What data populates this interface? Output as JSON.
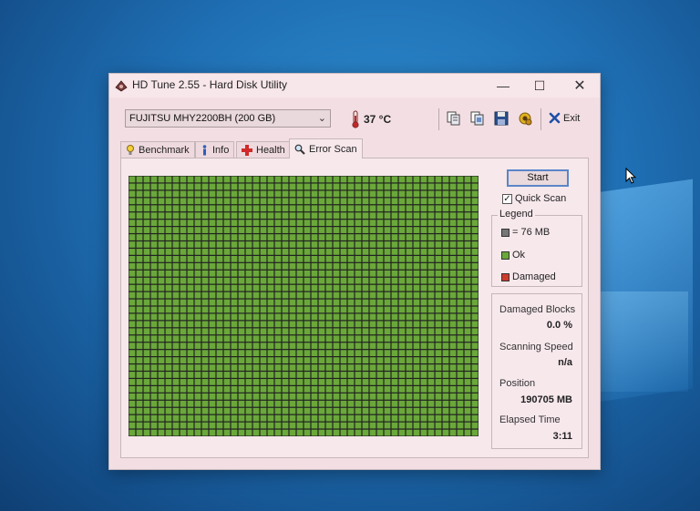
{
  "window": {
    "title": "HD Tune 2.55 - Hard Disk Utility",
    "controls": {
      "minimize": "—",
      "maximize": "☐",
      "close": "✕"
    }
  },
  "toolbar": {
    "drive": "FUJITSU MHY2200BH (200 GB)",
    "temperature": "37 °C",
    "exit_label": "Exit",
    "icons": [
      "copy-text-icon",
      "copy-screenshot-icon",
      "save-icon",
      "options-icon"
    ]
  },
  "tabs": [
    {
      "label": "Benchmark",
      "icon": "benchmark-icon",
      "active": false
    },
    {
      "label": "Info",
      "icon": "info-icon",
      "active": false
    },
    {
      "label": "Health",
      "icon": "health-icon",
      "active": false
    },
    {
      "label": "Error Scan",
      "icon": "magnifier-icon",
      "active": true
    }
  ],
  "error_scan": {
    "start_label": "Start",
    "quick_scan_label": "Quick Scan",
    "quick_scan_checked": true,
    "legend": {
      "title": "Legend",
      "block_size": "= 76 MB",
      "ok": "Ok",
      "damaged": "Damaged"
    },
    "stats": {
      "damaged_blocks_label": "Damaged Blocks",
      "damaged_blocks_value": "0.0 %",
      "scanning_speed_label": "Scanning Speed",
      "scanning_speed_value": "n/a",
      "position_label": "Position",
      "position_value": "190705 MB",
      "elapsed_time_label": "Elapsed Time",
      "elapsed_time_value": "3:11"
    },
    "block_grid": {
      "columns": 48,
      "rows": 36,
      "status": "ok"
    }
  },
  "colors": {
    "ok_block": "#6aa83a",
    "damaged_block": "#cc3b2b",
    "unscanned_block": "#777777",
    "grid_line": "#222222",
    "start_border": "#5a86c8"
  }
}
